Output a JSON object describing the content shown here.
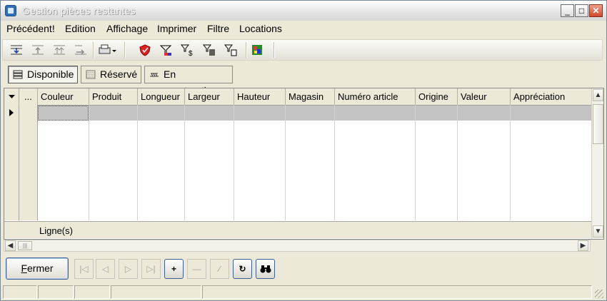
{
  "window": {
    "title": "Gestion pièces restantes",
    "controls": {
      "minimize": "_",
      "maximize": "□",
      "close": "✕"
    }
  },
  "menu": [
    "Précédent!",
    "Edition",
    "Affichage",
    "Imprimer",
    "Filtre",
    "Locations"
  ],
  "toolbar": {
    "icons": [
      "import-down-icon",
      "export-up-icon",
      "export-up-all-icon",
      "export-right-icon",
      "printer-icon",
      "shield-icon",
      "filter-color-icon",
      "filter-price-icon",
      "filter-barcode-icon",
      "filter-document-icon",
      "map-icon"
    ]
  },
  "status_tabs": [
    {
      "label": "Disponible",
      "active": true,
      "icon": "stack-icon"
    },
    {
      "label": "Réservé",
      "active": false,
      "icon": "stack-hatched-icon"
    },
    {
      "label": "En construction",
      "active": false,
      "icon": "construction-icon"
    }
  ],
  "grid": {
    "ellipsis": "...",
    "columns": [
      "Couleur",
      "Produit",
      "Longueur",
      "Largeur",
      "Hauteur",
      "Magasin",
      "Numéro article",
      "Origine",
      "Valeur",
      "Appréciation"
    ],
    "rows": [],
    "footer_label": "Ligne(s)"
  },
  "bottom": {
    "close_label": "Fermer",
    "close_accel": "F",
    "close_rest": "ermer",
    "nav": [
      {
        "name": "first-record-button",
        "glyph": "|◁",
        "enabled": false
      },
      {
        "name": "previous-record-button",
        "glyph": "◁",
        "enabled": false
      },
      {
        "name": "next-record-button",
        "glyph": "▷",
        "enabled": false
      },
      {
        "name": "last-record-button",
        "glyph": "▷|",
        "enabled": false
      },
      {
        "name": "add-record-button",
        "glyph": "+",
        "enabled": true
      },
      {
        "name": "delete-record-button",
        "glyph": "—",
        "enabled": false
      },
      {
        "name": "edit-record-button",
        "glyph": "∕",
        "enabled": false
      },
      {
        "name": "refresh-button",
        "glyph": "↻",
        "enabled": true
      },
      {
        "name": "search-button",
        "glyph": "⌕",
        "enabled": true
      }
    ]
  }
}
